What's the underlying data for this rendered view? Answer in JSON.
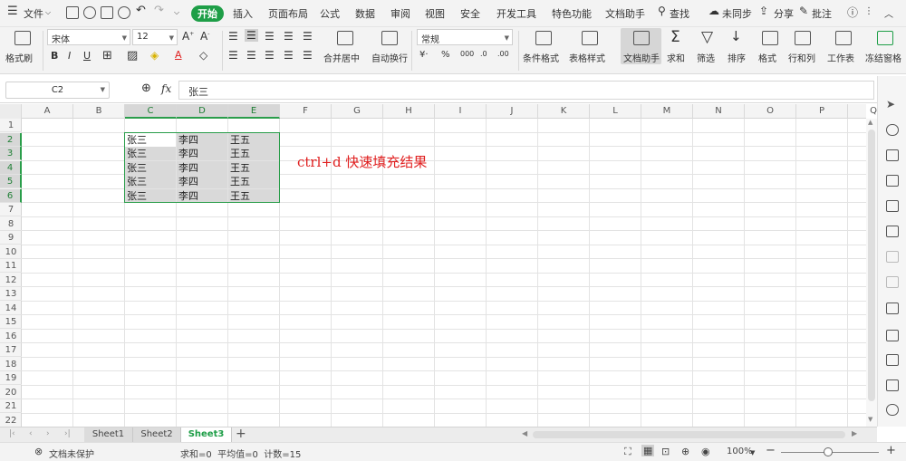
{
  "menubar": {
    "file_label": "文件",
    "tabs": [
      "开始",
      "插入",
      "页面布局",
      "公式",
      "数据",
      "审阅",
      "视图",
      "安全",
      "开发工具",
      "特色功能",
      "文档助手"
    ],
    "active_tab": "开始",
    "search_label": "查找",
    "sync_label": "未同步",
    "share_label": "分享",
    "comment_label": "批注"
  },
  "ribbon": {
    "format_painter": "格式刷",
    "font_name": "宋体",
    "font_size": "12",
    "merge_center": "合并居中",
    "wrap_text": "自动换行",
    "number_format": "常规",
    "conditional_format": "条件格式",
    "table_style": "表格样式",
    "doc_helper": "文档助手",
    "sum": "求和",
    "filter": "筛选",
    "sort": "排序",
    "format": "格式",
    "row_col": "行和列",
    "worksheet": "工作表",
    "freeze": "冻结窗格"
  },
  "formula_bar": {
    "name_box": "C2",
    "fx_label": "fx",
    "content": "张三"
  },
  "grid": {
    "columns": [
      "A",
      "B",
      "C",
      "D",
      "E",
      "F",
      "G",
      "H",
      "I",
      "J",
      "K",
      "L",
      "M",
      "N",
      "O",
      "P",
      "Q"
    ],
    "rows": [
      "1",
      "2",
      "3",
      "4",
      "5",
      "6",
      "7",
      "8",
      "9",
      "10",
      "11",
      "12",
      "13",
      "14",
      "15",
      "16",
      "17",
      "18",
      "19",
      "20",
      "21",
      "22"
    ],
    "selected_columns": [
      "C",
      "D",
      "E"
    ],
    "selected_rows": [
      "2",
      "3",
      "4",
      "5",
      "6"
    ],
    "active_cell": "C2",
    "data": [
      [
        "张三",
        "李四",
        "王五"
      ],
      [
        "张三",
        "李四",
        "王五"
      ],
      [
        "张三",
        "李四",
        "王五"
      ],
      [
        "张三",
        "李四",
        "王五"
      ],
      [
        "张三",
        "李四",
        "王五"
      ]
    ],
    "annotation": "ctrl+d 快速填充结果",
    "annotation_color": "#e02020"
  },
  "sheets": {
    "tabs": [
      "Sheet1",
      "Sheet2",
      "Sheet3"
    ],
    "active": "Sheet3"
  },
  "status": {
    "protection": "文档未保护",
    "summary": "求和=0  平均值=0  计数=15",
    "zoom": "100%"
  },
  "colors": {
    "accent": "#1e9e47",
    "selection_border": "#2a9d4a",
    "selection_fill": "#d9d9d9"
  }
}
